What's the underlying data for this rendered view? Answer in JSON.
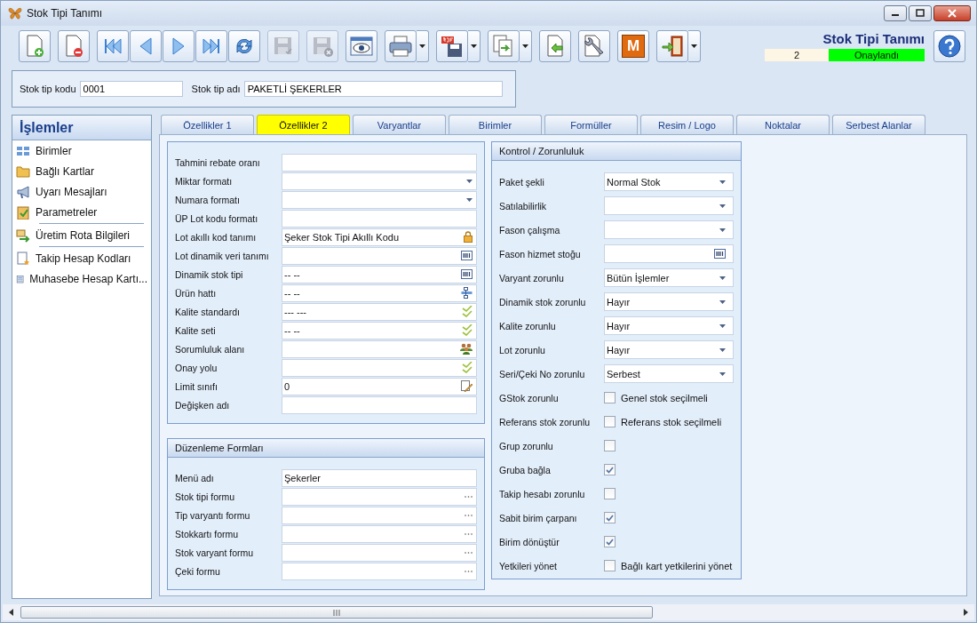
{
  "window": {
    "title": "Stok Tipi Tanımı"
  },
  "toolbar": [
    {
      "kind": "new",
      "disabled": false,
      "menu": false
    },
    {
      "kind": "delete",
      "disabled": false,
      "menu": false
    },
    {
      "kind": "first",
      "disabled": false,
      "menu": false
    },
    {
      "kind": "prev",
      "disabled": false,
      "menu": false
    },
    {
      "kind": "next",
      "disabled": false,
      "menu": false
    },
    {
      "kind": "last",
      "disabled": false,
      "menu": false
    },
    {
      "kind": "refresh",
      "disabled": false,
      "menu": false
    },
    {
      "kind": "save",
      "disabled": true,
      "menu": false
    },
    {
      "kind": "discard",
      "disabled": true,
      "menu": false
    },
    {
      "kind": "preview",
      "disabled": false,
      "menu": false
    },
    {
      "kind": "print",
      "disabled": false,
      "menu": true
    },
    {
      "kind": "pdf",
      "disabled": false,
      "menu": true
    },
    {
      "kind": "export",
      "disabled": false,
      "menu": true
    },
    {
      "kind": "import",
      "disabled": false,
      "menu": false
    },
    {
      "kind": "tools",
      "disabled": false,
      "menu": false
    },
    {
      "kind": "letter",
      "label": "M",
      "disabled": false,
      "menu": false
    },
    {
      "kind": "exit",
      "disabled": false,
      "menu": true
    }
  ],
  "form_heading": "Stok Tipi Tanımı",
  "status": {
    "number": "2",
    "state": "Onaylandı",
    "color": "#00ff00"
  },
  "header_fields": [
    {
      "label": "Stok tip kodu",
      "value": "0001"
    },
    {
      "label": "Stok tip adı",
      "value": "PAKETLİ ŞEKERLER"
    }
  ],
  "sidebar": {
    "title": "İşlemler",
    "groups": [
      [
        {
          "label": "Birimler",
          "kind": "grid"
        },
        {
          "label": "Bağlı Kartlar",
          "kind": "folder"
        },
        {
          "label": "Uyarı Mesajları",
          "kind": "megaphone"
        },
        {
          "label": "Parametreler",
          "kind": "clipboard"
        }
      ],
      [
        {
          "label": "Üretim Rota Bilgileri",
          "kind": "route"
        }
      ],
      [
        {
          "label": "Takip Hesap Kodları",
          "kind": "document"
        },
        {
          "label": "Muhasebe Hesap Kartı...",
          "kind": "calculator"
        }
      ]
    ]
  },
  "tabs": [
    {
      "label": "Özellikler 1",
      "selected": false
    },
    {
      "label": "Özellikler 2",
      "selected": true
    },
    {
      "label": "Varyantlar",
      "selected": false
    },
    {
      "label": "Birimler",
      "selected": false
    },
    {
      "label": "Formüller",
      "selected": false
    },
    {
      "label": "Resim / Logo",
      "selected": false
    },
    {
      "label": "Noktalar",
      "selected": false
    },
    {
      "label": "Serbest Alanlar",
      "selected": false
    }
  ],
  "properties": [
    {
      "label": "Tahmini rebate oranı",
      "kind": "text"
    },
    {
      "label": "Miktar formatı",
      "kind": "dropdown"
    },
    {
      "label": "Numara formatı",
      "kind": "dropdown"
    },
    {
      "label": "ÜP Lot kodu formatı",
      "kind": "text"
    },
    {
      "label": "Lot akıllı kod tanımı",
      "kind": "lock",
      "value": "Şeker Stok Tipi Akıllı Kodu"
    },
    {
      "label": "Lot dinamik veri tanımı",
      "kind": "code"
    },
    {
      "label": "Dinamik stok tipi",
      "kind": "code",
      "value": "-- --"
    },
    {
      "label": "Ürün hattı",
      "kind": "tree",
      "value": "-- --"
    },
    {
      "label": "Kalite standardı",
      "kind": "check",
      "value": "--- ---"
    },
    {
      "label": "Kalite seti",
      "kind": "check",
      "value": "-- --"
    },
    {
      "label": "Sorumluluk alanı",
      "kind": "people"
    },
    {
      "label": "Onay yolu",
      "kind": "check"
    },
    {
      "label": "Limit sınıfı",
      "kind": "note",
      "value": "0"
    },
    {
      "label": "Değişken adı",
      "kind": "text"
    }
  ],
  "edit_forms": {
    "title": "Düzenleme Formları",
    "fields": [
      {
        "label": "Menü adı",
        "kind": "text",
        "value": "Şekerler"
      },
      {
        "label": "Stok tipi formu",
        "kind": "ellipsis"
      },
      {
        "label": "Tip varyantı formu",
        "kind": "ellipsis"
      },
      {
        "label": "Stokkartı formu",
        "kind": "ellipsis"
      },
      {
        "label": "Stok varyant formu",
        "kind": "ellipsis"
      },
      {
        "label": "Çeki formu",
        "kind": "ellipsis"
      }
    ]
  },
  "control": {
    "title": "Kontrol / Zorunluluk",
    "rows": [
      {
        "label": "Paket şekli",
        "kind": "dropdown",
        "value": "Normal Stok"
      },
      {
        "label": "Satılabilirlik",
        "kind": "dropdown"
      },
      {
        "label": "Fason çalışma",
        "kind": "dropdown"
      },
      {
        "label": "Fason hizmet stoğu",
        "kind": "code"
      },
      {
        "label": "Varyant zorunlu",
        "kind": "dropdown",
        "value": "Bütün İşlemler"
      },
      {
        "label": "Dinamik stok zorunlu",
        "kind": "dropdown",
        "value": "Hayır"
      },
      {
        "label": "Kalite zorunlu",
        "kind": "dropdown",
        "value": "Hayır"
      },
      {
        "label": "Lot zorunlu",
        "kind": "dropdown",
        "value": "Hayır"
      },
      {
        "label": "Seri/Çeki No zorunlu",
        "kind": "dropdown",
        "value": "Serbest"
      },
      {
        "label": "GStok zorunlu",
        "kind": "checkbox",
        "checked": false,
        "caption": "Genel stok seçilmeli"
      },
      {
        "label": "Referans stok zorunlu",
        "kind": "checkbox",
        "checked": false,
        "caption": "Referans stok seçilmeli"
      },
      {
        "label": "Grup zorunlu",
        "kind": "checkbox",
        "checked": false
      },
      {
        "label": "Gruba bağla",
        "kind": "checkbox",
        "checked": true
      },
      {
        "label": "Takip hesabı zorunlu",
        "kind": "checkbox",
        "checked": false
      },
      {
        "label": "Sabit birim çarpanı",
        "kind": "checkbox",
        "checked": true
      },
      {
        "label": "Birim dönüştür",
        "kind": "checkbox",
        "checked": true
      },
      {
        "label": "Yetkileri yönet",
        "kind": "checkbox",
        "checked": false,
        "caption": "Bağlı kart yetkilerini yönet"
      }
    ]
  }
}
